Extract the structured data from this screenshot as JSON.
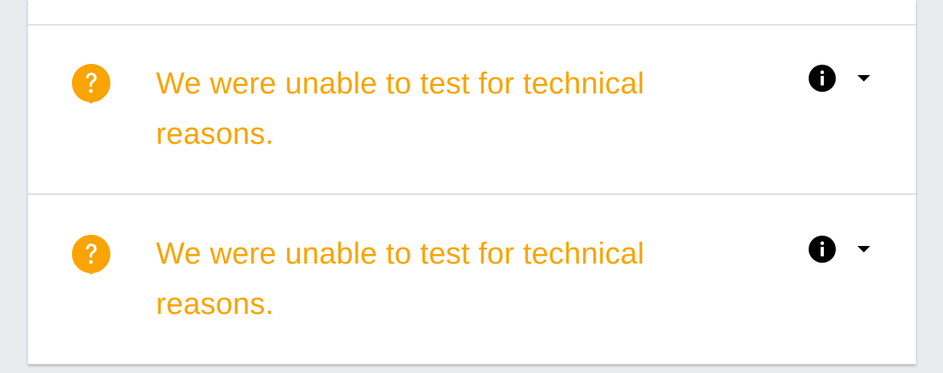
{
  "results": [
    {
      "message": "We were unable to test for technical reasons.",
      "status_icon": "question-bubble-icon",
      "info_icon": "info-icon",
      "expand_icon": "caret-down-icon"
    },
    {
      "message": "We were unable to test for technical reasons.",
      "status_icon": "question-bubble-icon",
      "info_icon": "info-icon",
      "expand_icon": "caret-down-icon"
    }
  ],
  "colors": {
    "warning": "#f9a400",
    "background": "#e8ebee",
    "card": "#ffffff",
    "divider": "#dfe1e4",
    "icon": "#000000"
  }
}
